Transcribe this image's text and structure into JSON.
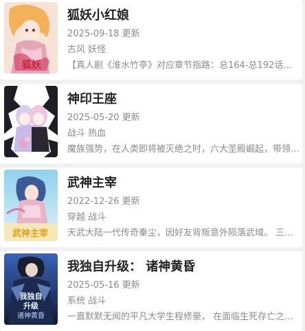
{
  "comics": [
    {
      "title": "狐妖小红娘",
      "date": "2025-09-18 更新",
      "tags": "古风 妖怪",
      "description": "【真人剧《淮水竹亭》对应章节指路：总164-总192话】 …",
      "cover_colors": [
        "#f6d9c9",
        "#e3a6b4",
        "#f3b25a",
        "#d8577a"
      ]
    },
    {
      "title": "神印王座",
      "date": "2025-05-20 更新",
      "tags": "战斗 热血",
      "description": "魔族强势，在人类即将被灭绝之时，六大圣殿崛起，带领…",
      "cover_colors": [
        "#fafafa",
        "#1e1e24",
        "#c9b9e6",
        "#e2a6c8"
      ]
    },
    {
      "title": "武神主宰",
      "date": "2022-12-26 更新",
      "tags": "穿越 战斗",
      "description": "天武大陆一代传奇秦尘，因好友背叛意外陨落武域。 三百…",
      "cover_colors": [
        "#8fd0ee",
        "#3c5a96",
        "#e8b4c8",
        "#f2d24a"
      ]
    },
    {
      "title": "我独自升级： 诸神黄昏",
      "date": "2025-05-16 更新",
      "tags": "系统 战斗",
      "description": "一直默默无闻的平凡大学生程修豪， 在面临生死存亡之际…",
      "cover_colors": [
        "#1c2a4e",
        "#3b63b8",
        "#8fb6ff",
        "#e9f0ff"
      ]
    }
  ]
}
